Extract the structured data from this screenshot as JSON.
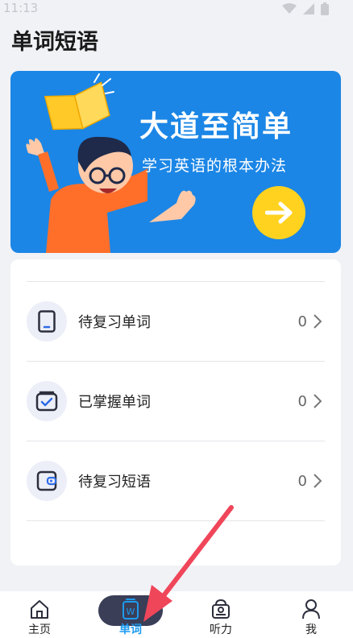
{
  "status": {
    "time": "11:13"
  },
  "header": {
    "title": "单词短语"
  },
  "banner": {
    "title": "大道至简单",
    "subtitle": "学习英语的根本办法"
  },
  "list": [
    {
      "label": "待复习单词",
      "count": "0",
      "icon": "tablet-icon"
    },
    {
      "label": "已掌握单词",
      "count": "0",
      "icon": "checked-box-icon"
    },
    {
      "label": "待复习短语",
      "count": "0",
      "icon": "wallet-icon"
    }
  ],
  "tabs": [
    {
      "label": "主页",
      "icon": "home-icon",
      "active": false
    },
    {
      "label": "单词",
      "icon": "word-book-icon",
      "active": true
    },
    {
      "label": "听力",
      "icon": "radio-icon",
      "active": false
    },
    {
      "label": "我",
      "icon": "person-icon",
      "active": false
    }
  ],
  "colors": {
    "banner": "#1b86e6",
    "arrow_button": "#ffd21f",
    "active_tab": "#1e9bf0",
    "annotation_arrow": "#f0465a"
  }
}
